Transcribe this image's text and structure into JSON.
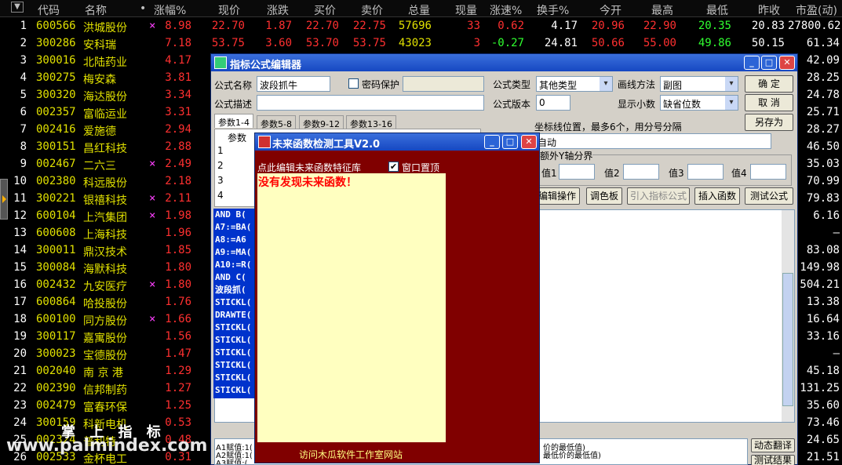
{
  "grid": {
    "headers": [
      "代码",
      "名称",
      "•",
      "涨幅%",
      "现价",
      "涨跌",
      "买价",
      "卖价",
      "总量",
      "现量",
      "涨速%",
      "换手%",
      "今开",
      "最高",
      "最低",
      "昨收",
      "市盈(动)"
    ],
    "rows": [
      {
        "n": "1",
        "code": "600566",
        "name": "洪城股份",
        "m": "×",
        "chg": "8.98",
        "price": "22.70",
        "up": "1.87",
        "buy": "22.70",
        "sell": "22.75",
        "vol": "57696",
        "cur": "33",
        "spd": "0.62",
        "turn": "4.17",
        "open": "20.96",
        "high": "22.90",
        "low": "20.35",
        "prev": "20.83",
        "pe": "27800.62"
      },
      {
        "n": "2",
        "code": "300286",
        "name": "安科瑞",
        "m": "",
        "chg": "7.18",
        "price": "53.75",
        "up": "3.60",
        "buy": "53.70",
        "sell": "53.75",
        "vol": "43023",
        "cur": "3",
        "spd": "-0.27",
        "turn": "24.81",
        "open": "50.66",
        "high": "55.00",
        "low": "49.86",
        "prev": "50.15",
        "pe": "61.34"
      },
      {
        "n": "3",
        "code": "300016",
        "name": "北陆药业",
        "m": "",
        "chg": "4.17",
        "pe": "42.09"
      },
      {
        "n": "4",
        "code": "300275",
        "name": "梅安森",
        "m": "",
        "chg": "3.81",
        "pe": "28.25"
      },
      {
        "n": "5",
        "code": "300320",
        "name": "海达股份",
        "m": "",
        "chg": "3.34",
        "pe": "24.78"
      },
      {
        "n": "6",
        "code": "002357",
        "name": "富临运业",
        "m": "",
        "chg": "3.31",
        "pe": "25.71"
      },
      {
        "n": "7",
        "code": "002416",
        "name": "爱施德",
        "m": "",
        "chg": "2.94",
        "pe": "28.27"
      },
      {
        "n": "8",
        "code": "300151",
        "name": "昌红科技",
        "m": "",
        "chg": "2.88",
        "pe": "46.50"
      },
      {
        "n": "9",
        "code": "002467",
        "name": "二六三",
        "m": "×",
        "chg": "2.49",
        "pe": "35.03"
      },
      {
        "n": "10",
        "code": "002380",
        "name": "科远股份",
        "m": "",
        "chg": "2.18",
        "pe": "70.99"
      },
      {
        "n": "11",
        "code": "300221",
        "name": "银禧科技",
        "m": "×",
        "chg": "2.11",
        "pe": "79.83"
      },
      {
        "n": "12",
        "code": "600104",
        "name": "上汽集团",
        "m": "×",
        "chg": "1.98",
        "pe": "6.16"
      },
      {
        "n": "13",
        "code": "600608",
        "name": "上海科技",
        "m": "",
        "chg": "1.96",
        "pe": "–"
      },
      {
        "n": "14",
        "code": "300011",
        "name": "鼎汉技术",
        "m": "",
        "chg": "1.85",
        "pe": "83.08"
      },
      {
        "n": "15",
        "code": "300084",
        "name": "海默科技",
        "m": "",
        "chg": "1.80",
        "pe": "149.98"
      },
      {
        "n": "16",
        "code": "002432",
        "name": "九安医疗",
        "m": "×",
        "chg": "1.80",
        "pe": "504.21"
      },
      {
        "n": "17",
        "code": "600864",
        "name": "哈投股份",
        "m": "",
        "chg": "1.76",
        "pe": "13.38"
      },
      {
        "n": "18",
        "code": "600100",
        "name": "同方股份",
        "m": "×",
        "chg": "1.66",
        "pe": "16.64"
      },
      {
        "n": "19",
        "code": "300117",
        "name": "嘉寓股份",
        "m": "",
        "chg": "1.56",
        "pe": "33.16"
      },
      {
        "n": "20",
        "code": "300023",
        "name": "宝德股份",
        "m": "",
        "chg": "1.47",
        "pe": "–"
      },
      {
        "n": "21",
        "code": "002040",
        "name": "南 京 港",
        "m": "",
        "chg": "1.29",
        "pe": "45.18"
      },
      {
        "n": "22",
        "code": "002390",
        "name": "信邦制药",
        "m": "",
        "chg": "1.27",
        "pe": "131.25"
      },
      {
        "n": "23",
        "code": "002479",
        "name": "富春环保",
        "m": "",
        "chg": "1.25",
        "pe": "35.60"
      },
      {
        "n": "24",
        "code": "300159",
        "name": "科新电机",
        "m": "",
        "chg": "0.53",
        "pe": "73.46"
      },
      {
        "n": "25",
        "code": "002324",
        "name": "普利特",
        "m": "",
        "chg": "0.48",
        "pe": "24.65"
      },
      {
        "n": "26",
        "code": "002533",
        "name": "金杯电工",
        "m": "",
        "chg": "0.31",
        "pe": "21.51"
      }
    ]
  },
  "editor": {
    "title": "指标公式编辑器",
    "name_label": "公式名称",
    "name_value": "波段抓牛",
    "pwd_label": "密码保护",
    "type_label": "公式类型",
    "type_value": "其他类型",
    "draw_label": "画线方法",
    "draw_value": "副图",
    "ok": "确  定",
    "cancel": "取  消",
    "saveas": "另存为",
    "desc_label": "公式描述",
    "ver_label": "公式版本",
    "ver_value": "0",
    "decimal_label": "显示小数",
    "decimal_value": "缺省位数",
    "tabs": [
      "参数1-4",
      "参数5-8",
      "参数9-12",
      "参数13-16"
    ],
    "param_hdr": "参数",
    "param_rows": [
      "1",
      "2",
      "3",
      "4"
    ],
    "coord_label": "坐标线位置，最多6个，用分号分隔",
    "coord_value": "自动",
    "extra_label": "额外Y轴分界",
    "vals": [
      "值1",
      "值2",
      "值3",
      "值4"
    ],
    "btns": [
      "编辑操作",
      "调色板",
      "引入指标公式",
      "插入函数",
      "测试公式"
    ],
    "code_lines": [
      "AND B(",
      "A7:=BA(",
      "A8:=A6",
      "A9:=MA(",
      "A10:=R(",
      "AND C(",
      "波段抓(",
      "STICKL(",
      "DRAWTE(",
      "STICKL(",
      "STICKL(",
      "STICKL(",
      "STICKL(",
      "STICKL(",
      "STICKL("
    ],
    "notes": [
      "A1赋值:1(",
      "A2赋值:1(",
      "A3赋值:("
    ],
    "note_right": [
      "价的最低值)",
      "最低价的最低值)"
    ],
    "dyn_btn": "动态翻译",
    "test_btn": "测试结果"
  },
  "future": {
    "title": "未来函数检测工具V2.0",
    "edit_link": "点此编辑未来函数特征库",
    "ontop_label": "窗口置顶",
    "result": "没有发现未来函数！",
    "footer": "访问木瓜软件工作室网站"
  },
  "watermark": {
    "line1": "掌 上 指 标",
    "line2": "www.palmindex.com"
  },
  "colors": {
    "code": "#e0e000",
    "name": "#e0e000",
    "up": "#ff3030",
    "down": "#30ff30",
    "white": "#ffffff"
  }
}
